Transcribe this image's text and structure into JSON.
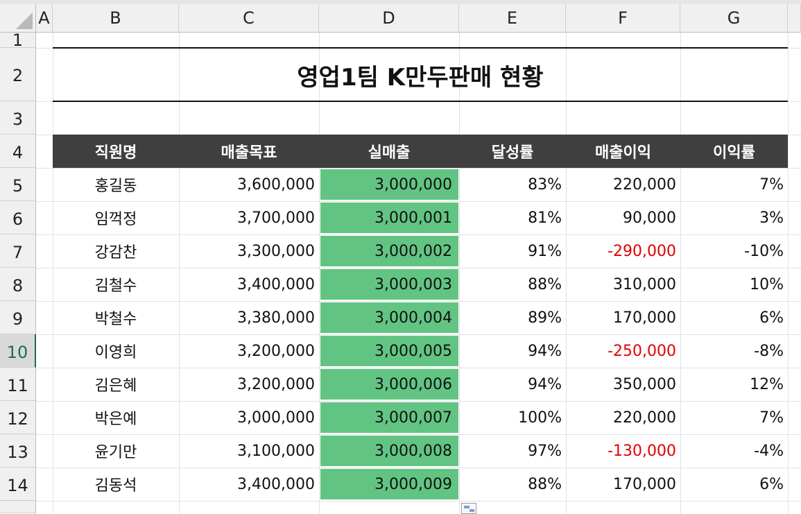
{
  "columns": [
    "A",
    "B",
    "C",
    "D",
    "E",
    "F",
    "G"
  ],
  "rows": [
    "1",
    "2",
    "3",
    "4",
    "5",
    "6",
    "7",
    "8",
    "9",
    "10",
    "11",
    "12",
    "13",
    "14"
  ],
  "selected_row": "10",
  "title": "영업1팀 K만두판매 현황",
  "headers": [
    "직원명",
    "매출목표",
    "실매출",
    "달성률",
    "매출이익",
    "이익률"
  ],
  "data": [
    [
      "홍길동",
      "3,600,000",
      "3,000,000",
      "83%",
      "220,000",
      "7%"
    ],
    [
      "임꺽정",
      "3,700,000",
      "3,000,001",
      "81%",
      "90,000",
      "3%"
    ],
    [
      "강감찬",
      "3,300,000",
      "3,000,002",
      "91%",
      "-290,000",
      "-10%"
    ],
    [
      "김철수",
      "3,400,000",
      "3,000,003",
      "88%",
      "310,000",
      "10%"
    ],
    [
      "박철수",
      "3,380,000",
      "3,000,004",
      "89%",
      "170,000",
      "6%"
    ],
    [
      "이영희",
      "3,200,000",
      "3,000,005",
      "94%",
      "-250,000",
      "-8%"
    ],
    [
      "김은혜",
      "3,200,000",
      "3,000,006",
      "94%",
      "350,000",
      "12%"
    ],
    [
      "박은예",
      "3,000,000",
      "3,000,007",
      "100%",
      "220,000",
      "7%"
    ],
    [
      "윤기만",
      "3,100,000",
      "3,000,008",
      "97%",
      "-130,000",
      "-4%"
    ],
    [
      "김동석",
      "3,400,000",
      "3,000,009",
      "88%",
      "170,000",
      "6%"
    ]
  ],
  "colors": {
    "header_band": "#3f3f3f",
    "actual_sales_fill": "#62c483",
    "negative_value": "#e00000",
    "selected_row_header": "#1e6e42"
  }
}
